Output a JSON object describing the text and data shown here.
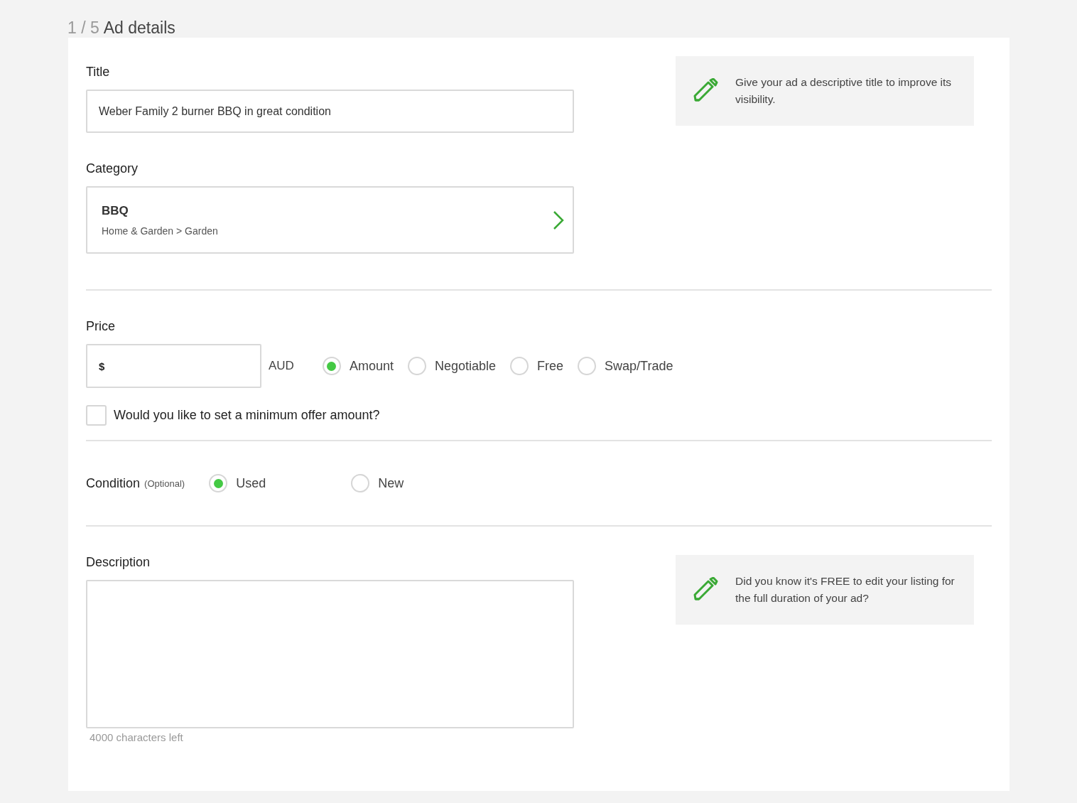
{
  "header": {
    "step": "1 / 5",
    "title": "Ad details"
  },
  "title_field": {
    "label": "Title",
    "value": "Weber Family 2 burner BBQ in great condition"
  },
  "title_tip": {
    "text": "Give your ad a descriptive title to improve its visibility."
  },
  "category": {
    "label": "Category",
    "name": "BBQ",
    "path": "Home & Garden > Garden"
  },
  "price": {
    "label": "Price",
    "currency_symbol": "$",
    "currency": "AUD",
    "options": [
      {
        "label": "Amount",
        "selected": true
      },
      {
        "label": "Negotiable",
        "selected": false
      },
      {
        "label": "Free",
        "selected": false
      },
      {
        "label": "Swap/Trade",
        "selected": false
      }
    ]
  },
  "minimum_offer": {
    "label": "Would you like to set a minimum offer amount?",
    "checked": false
  },
  "condition": {
    "label": "Condition",
    "note": "(Optional)",
    "options": [
      {
        "label": "Used",
        "selected": true
      },
      {
        "label": "New",
        "selected": false
      }
    ]
  },
  "description": {
    "label": "Description",
    "counter": "4000 characters left"
  },
  "description_tip": {
    "text": "Did you know it's FREE to edit your listing for the full duration of your ad?"
  }
}
